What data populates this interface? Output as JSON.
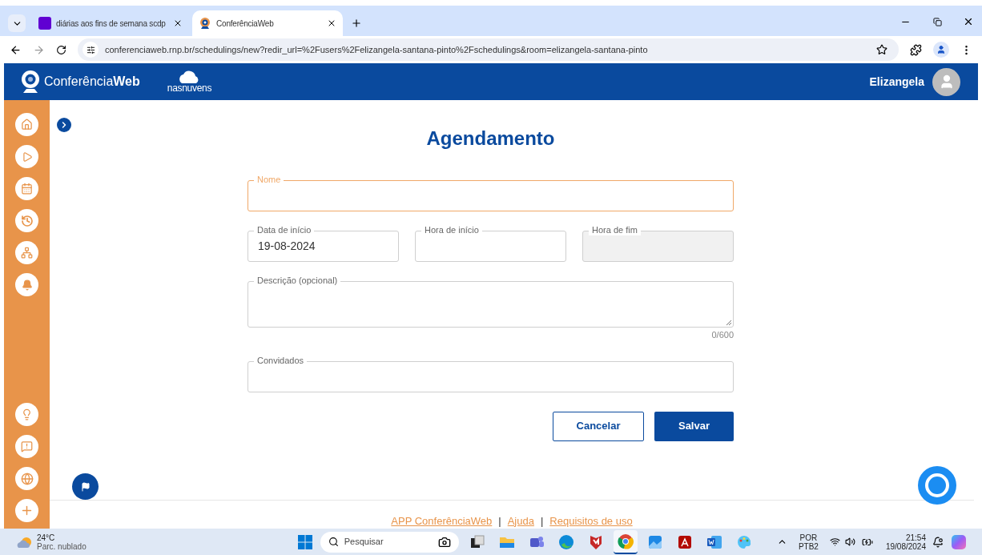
{
  "browser": {
    "tabs": [
      {
        "title": "diárias aos fins de semana scdp",
        "kind": "yahoo",
        "selected": false
      },
      {
        "title": "ConferênciaWeb",
        "kind": "webcam",
        "selected": true
      }
    ],
    "url": "conferenciaweb.rnp.br/schedulings/new?redir_url=%2Fusers%2Felizangela-santana-pinto%2Fschedulings&room=elizangela-santana-pinto"
  },
  "header": {
    "logo": "Conferência**Web**",
    "partner": "nasnuvens",
    "user": "Elizangela"
  },
  "form": {
    "title": "Agendamento",
    "rows": [
      [
        {
          "label": "Nome",
          "kind": "text",
          "focused": true,
          "disabled": false
        }
      ],
      [
        {
          "label": "Data de início",
          "kind": "text",
          "value": "19-08-2024",
          "focused": false,
          "disabled": false
        },
        {
          "label": "Hora de início",
          "kind": "text",
          "focused": false,
          "disabled": false
        },
        {
          "label": "Hora de fim",
          "kind": "text",
          "focused": false,
          "disabled": true
        }
      ],
      [
        {
          "label": "Descrição (opcional)",
          "kind": "textarea",
          "counter": "0/600",
          "focused": false,
          "disabled": false
        }
      ],
      [
        {
          "label": "Convidados",
          "kind": "text",
          "focused": false,
          "disabled": false
        }
      ]
    ],
    "buttons": [
      {
        "label": "Cancelar",
        "kind": "secondary"
      },
      {
        "label": "Salvar",
        "kind": "primary"
      }
    ]
  },
  "footer": {
    "links": [
      "APP ConferênciaWeb",
      "Ajuda",
      "Requisitos de uso"
    ],
    "separator": "|"
  },
  "taskbar": {
    "weather": {
      "temp": "24°C",
      "desc": "Parc. nublado"
    },
    "search": {
      "placeholder": "Pesquisar"
    },
    "apps": [
      {
        "kind": "taskview",
        "selected": false
      },
      {
        "kind": "explorer",
        "selected": false
      },
      {
        "kind": "teams",
        "selected": false
      },
      {
        "kind": "edge",
        "selected": false
      },
      {
        "kind": "shield",
        "selected": false
      },
      {
        "kind": "chrome",
        "selected": true
      },
      {
        "kind": "photos",
        "selected": false
      },
      {
        "kind": "acrobat",
        "selected": false
      },
      {
        "kind": "word",
        "selected": false
      },
      {
        "kind": "paint",
        "selected": false
      }
    ],
    "language": "POR",
    "layout": "PTB2",
    "time": "21:54",
    "date": "19/08/2024"
  }
}
